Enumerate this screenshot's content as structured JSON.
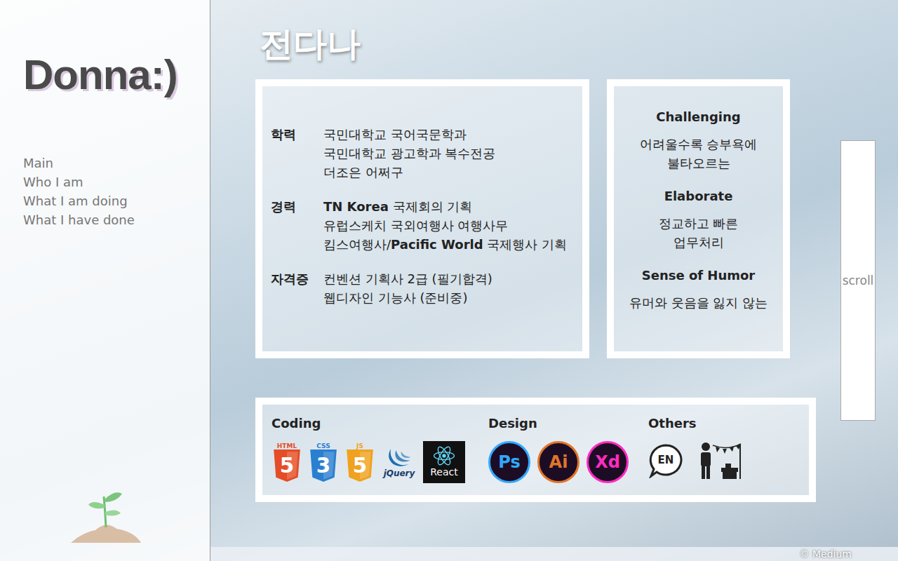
{
  "sidebar": {
    "logo": "Donna:)",
    "items": [
      {
        "label": "Main",
        "selected": false
      },
      {
        "label": "Who I am",
        "selected": false
      },
      {
        "label": "What I am doing",
        "selected": false
      },
      {
        "label": "What I have done",
        "selected": false
      }
    ]
  },
  "title": "전다나",
  "profile": [
    {
      "label": "학력",
      "lines": [
        [
          {
            "t": "국민대학교 국어국문학과",
            "b": false
          }
        ],
        [
          {
            "t": "국민대학교 광고학과 복수전공",
            "b": false
          }
        ],
        [
          {
            "t": "더조은 어쩌구",
            "b": false
          }
        ]
      ]
    },
    {
      "label": "경력",
      "lines": [
        [
          {
            "t": "TN Korea",
            "b": true
          },
          {
            "t": " 국제회의 기획",
            "b": false
          }
        ],
        [
          {
            "t": "유럽스케치 국외여행사 여행사무",
            "b": false
          }
        ],
        [
          {
            "t": "킴스여행사/",
            "b": false
          },
          {
            "t": "Pacific World",
            "b": true
          },
          {
            "t": " 국제행사 기획",
            "b": false
          }
        ]
      ]
    },
    {
      "label": "자격증",
      "lines": [
        [
          {
            "t": "컨벤션 기획사 2급 (필기합격)",
            "b": false
          }
        ],
        [
          {
            "t": "웹디자인 기능사 (준비중)",
            "b": false
          }
        ]
      ]
    }
  ],
  "traits": [
    {
      "title": "Challenging",
      "desc": [
        "어려울수록 승부욕에",
        "불타오르는"
      ]
    },
    {
      "title": "Elaborate",
      "desc": [
        "정교하고 빠른",
        "업무처리"
      ]
    },
    {
      "title": "Sense of Humor",
      "desc": [
        "유머와 웃음을 잃지 않는"
      ]
    }
  ],
  "skills": [
    {
      "title": "Coding",
      "items": [
        {
          "kind": "shield",
          "label": "HTML",
          "mark": "5",
          "color": "#e44d26"
        },
        {
          "kind": "shield",
          "label": "CSS",
          "mark": "3",
          "color": "#2a7fd0"
        },
        {
          "kind": "shield",
          "label": "JS",
          "mark": "5",
          "color": "#f0a21e"
        },
        {
          "kind": "jquery",
          "label": "jQuery",
          "mark": "",
          "color": "#1b6fb5"
        },
        {
          "kind": "react",
          "label": "React",
          "mark": "",
          "color": "#61dafb"
        }
      ]
    },
    {
      "title": "Design",
      "items": [
        {
          "kind": "circle",
          "label": "Ps",
          "mark": "",
          "color": "#31a8ff"
        },
        {
          "kind": "circle",
          "label": "Ai",
          "mark": "",
          "color": "#e0752c"
        },
        {
          "kind": "circle",
          "label": "Xd",
          "mark": "",
          "color": "#ff2bc2"
        }
      ]
    },
    {
      "title": "Others",
      "items": [
        {
          "kind": "speech",
          "label": "EN",
          "mark": "",
          "color": "#222222"
        },
        {
          "kind": "event",
          "label": "",
          "mark": "",
          "color": "#222222"
        }
      ]
    }
  ],
  "scroll": "scroll",
  "footer": "© Medium"
}
